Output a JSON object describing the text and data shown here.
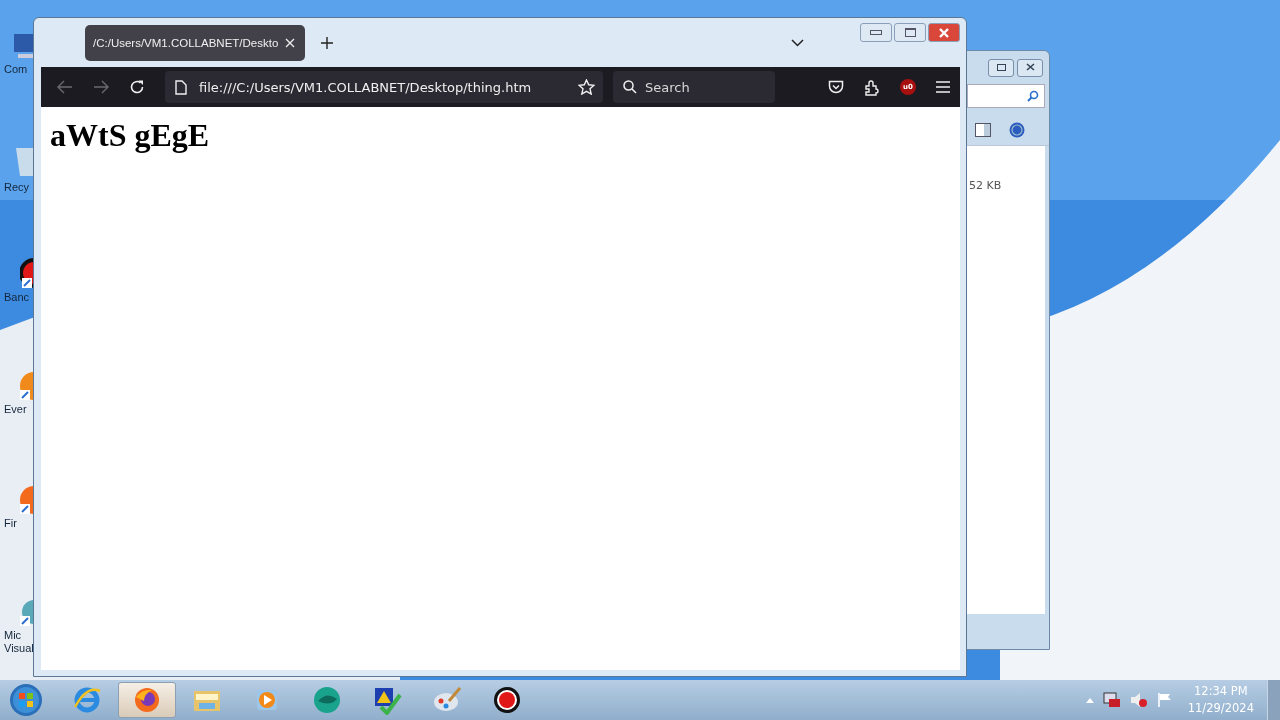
{
  "desktop_icons": [
    {
      "kind": "computer",
      "label": "Com"
    },
    {
      "kind": "bin",
      "label": "Recy"
    },
    {
      "kind": "record",
      "label": "Banc"
    },
    {
      "kind": "ever",
      "label": "Ever"
    },
    {
      "kind": "firefox",
      "label": "Fir"
    },
    {
      "kind": "studio",
      "label": "Mic Visual"
    }
  ],
  "background_window": {
    "size_text": "52 KB"
  },
  "browser": {
    "tabs": [
      {
        "title": "/C:/Users/VM1.COLLABNET/Deskto",
        "selected": true
      }
    ],
    "back_disabled": true,
    "forward_disabled": true,
    "url": "file:///C:/Users/VM1.COLLABNET/Desktop/thing.htm",
    "search": {
      "placeholder": "Search"
    },
    "extension_badge": "u0",
    "page": {
      "heading": "aWtS gEgE"
    }
  },
  "taskbar": {
    "apps": [
      {
        "kind": "ie",
        "selected": false
      },
      {
        "kind": "firefox",
        "selected": true
      },
      {
        "kind": "explorer",
        "selected": false
      },
      {
        "kind": "media",
        "selected": false
      },
      {
        "kind": "teal",
        "selected": false
      },
      {
        "kind": "check",
        "selected": false
      },
      {
        "kind": "paint",
        "selected": false
      },
      {
        "kind": "record",
        "selected": false
      }
    ],
    "clock": {
      "time": "12:34 PM",
      "date": "11/29/2024"
    }
  }
}
